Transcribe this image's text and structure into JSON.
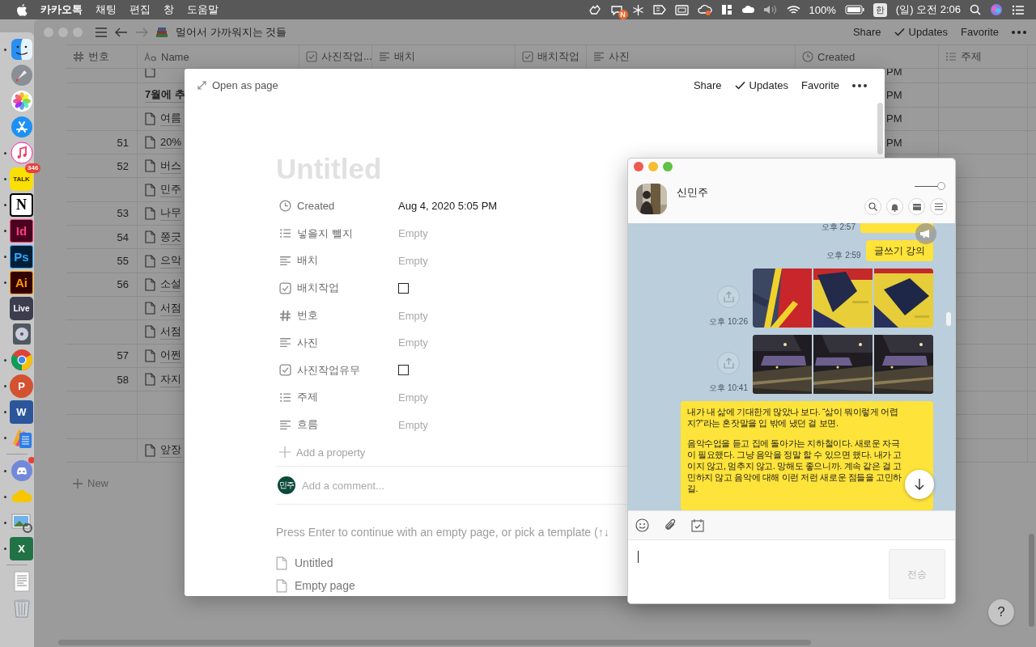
{
  "menu_bar": {
    "app_name": "카카오톡",
    "menus": [
      "채팅",
      "편집",
      "창",
      "도움말"
    ],
    "badge": "N",
    "battery": "100%",
    "input_source": "한",
    "clock": "(일) 오전 2:06"
  },
  "dock": {
    "items": [
      {
        "kind": "finder",
        "running": true
      },
      {
        "kind": "launchpad",
        "running": false
      },
      {
        "kind": "photos",
        "running": false
      },
      {
        "kind": "appstore",
        "running": false
      },
      {
        "kind": "music",
        "running": true
      },
      {
        "kind": "talk",
        "label": "TALK",
        "badge": "346",
        "running": true
      },
      {
        "kind": "notion",
        "label": "N",
        "running": true
      },
      {
        "kind": "indesign",
        "label": "Id",
        "running": true
      },
      {
        "kind": "photoshop",
        "label": "Ps",
        "running": true
      },
      {
        "kind": "illustrator",
        "label": "Ai",
        "running": true
      },
      {
        "kind": "live",
        "label": "Live",
        "running": false
      },
      {
        "kind": "disk",
        "running": false
      },
      {
        "kind": "chrome",
        "running": true
      },
      {
        "kind": "powerpoint",
        "label": "P",
        "running": true
      },
      {
        "kind": "word",
        "label": "W",
        "running": true
      },
      {
        "kind": "files",
        "running": true
      },
      {
        "kind": "separator"
      },
      {
        "kind": "discord",
        "running": true,
        "badge_dot": true
      },
      {
        "kind": "cloud",
        "running": true
      },
      {
        "kind": "preview",
        "running": true
      },
      {
        "kind": "excel",
        "label": "X",
        "running": true
      },
      {
        "kind": "separator"
      },
      {
        "kind": "document",
        "running": false
      },
      {
        "kind": "trash",
        "running": false
      }
    ]
  },
  "notion": {
    "breadcrumb": "멀어서 가까워지는 것들",
    "actions": [
      {
        "kind": "plain",
        "label": "Share"
      },
      {
        "kind": "check",
        "label": "Updates"
      },
      {
        "kind": "plain",
        "label": "Favorite"
      }
    ],
    "table": {
      "columns": [
        {
          "kind": "number",
          "label": "번호"
        },
        {
          "kind": "title",
          "label": "Name"
        },
        {
          "kind": "checkbox",
          "label": "사진작업..."
        },
        {
          "kind": "text",
          "label": "배치"
        },
        {
          "kind": "checkbox",
          "label": "배치작업"
        },
        {
          "kind": "text",
          "label": "사진"
        },
        {
          "kind": "created",
          "label": "Created"
        },
        {
          "kind": "list",
          "label": "주제"
        }
      ],
      "rows": [
        {
          "kind": "page",
          "created": "PM"
        },
        {
          "kind": "heading",
          "name": "7월에 추",
          "created": "PM"
        },
        {
          "kind": "page",
          "name": "여름",
          "created": "PM"
        },
        {
          "kind": "page",
          "number": "51",
          "name": "20%",
          "created": "PM"
        },
        {
          "kind": "page",
          "number": "52",
          "name": "버스"
        },
        {
          "kind": "page",
          "name": "민주"
        },
        {
          "kind": "page",
          "number": "53",
          "name": "나무"
        },
        {
          "kind": "page",
          "number": "54",
          "name": "쫑긋"
        },
        {
          "kind": "page",
          "number": "55",
          "name": "으악"
        },
        {
          "kind": "page",
          "number": "56",
          "name": "소설"
        },
        {
          "kind": "page",
          "name": "서점"
        },
        {
          "kind": "page",
          "name": "서점"
        },
        {
          "kind": "page",
          "number": "57",
          "name": "어쩐"
        },
        {
          "kind": "page",
          "number": "58",
          "name": "자지"
        },
        {
          "kind": "blank"
        },
        {
          "kind": "blank"
        },
        {
          "kind": "page",
          "name": "앞장"
        }
      ],
      "new_label": "New"
    },
    "help": "?"
  },
  "modal": {
    "open_label": "Open as page",
    "actions": [
      {
        "kind": "plain",
        "label": "Share"
      },
      {
        "kind": "check",
        "label": "Updates"
      },
      {
        "kind": "plain",
        "label": "Favorite"
      }
    ],
    "title_placeholder": "Untitled",
    "properties": [
      {
        "kind": "created",
        "label": "Created",
        "value": "Aug 4, 2020 5:05 PM"
      },
      {
        "kind": "list",
        "label": "넣을지 뺄지",
        "value": "Empty"
      },
      {
        "kind": "text",
        "label": "배치",
        "value": "Empty"
      },
      {
        "kind": "checkbox",
        "label": "배치작업",
        "checked": false
      },
      {
        "kind": "number",
        "label": "번호",
        "value": "Empty"
      },
      {
        "kind": "text",
        "label": "사진",
        "value": "Empty"
      },
      {
        "kind": "checkbox",
        "label": "사진작업유무",
        "checked": false
      },
      {
        "kind": "list",
        "label": "주제",
        "value": "Empty"
      },
      {
        "kind": "text",
        "label": "흐름",
        "value": "Empty"
      }
    ],
    "add_property": "Add a property",
    "comment": {
      "avatar": "민주",
      "placeholder": "Add a comment..."
    },
    "hint": "Press Enter to continue with an empty page, or pick a template (↑↓",
    "templates": [
      "Untitled",
      "Empty page"
    ]
  },
  "chat": {
    "name": "신민주",
    "opacity_slider": {
      "level": 1
    },
    "messages": [
      {
        "kind": "clipped",
        "time": "오후 2:57"
      },
      {
        "kind": "text",
        "paragraphs": [
          "글쓰기 강의"
        ],
        "time": "오후 2:59"
      },
      {
        "kind": "photos",
        "time": "오후 10:26"
      },
      {
        "kind": "photos",
        "time": "오후 10:41"
      },
      {
        "kind": "text",
        "paragraphs": [
          "내가 내 삶에 기대한게 많았나 보다. “삶이 뭐이렇게 어렵지?”라는 혼잣말을 입 밖에 냈던 걸 보면.",
          "음악수업을 듣고 집에 돌아가는 지하철이다. 새로운 자극이 필요했다. 그냥 음악을 정말 할 수 있으면 했다. 내가 고이지 않고, 멈추지 않고. 망해도 좋으니까. 계속 같은 걸 고민하지 않고 음악에 대해 이런 저런 새로운 점들을 고민하길."
        ]
      }
    ],
    "input_focused": true,
    "send_label": "전송",
    "send_disabled": true
  }
}
